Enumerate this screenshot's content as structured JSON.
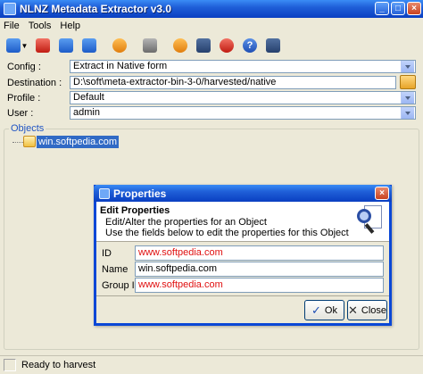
{
  "window": {
    "title": "NLNZ Metadata Extractor v3.0",
    "controls": [
      "_",
      "□",
      "×"
    ]
  },
  "menu": {
    "items": [
      "File",
      "Tools",
      "Help"
    ]
  },
  "toolbar": {
    "buttons": [
      "extract-dropdown-icon",
      "add-object-icon",
      "remove-object-icon",
      "remove-all-icon",
      "search-icon",
      "gear-icon",
      "clock-icon",
      "save-icon",
      "stopwatch-icon",
      "help-icon",
      "exit-icon"
    ],
    "help_glyph": "?"
  },
  "form": {
    "config_label": "Config :",
    "config_value": "Extract in Native form",
    "destination_label": "Destination :",
    "destination_value": "D:\\soft\\meta-extractor-bin-3-0/harvested/native",
    "profile_label": "Profile :",
    "profile_value": "Default",
    "user_label": "User :",
    "user_value": "admin"
  },
  "objects": {
    "legend": "Objects",
    "items": [
      "win.softpedia.com"
    ]
  },
  "status": {
    "text": "Ready to harvest"
  },
  "dialog": {
    "title": "Properties",
    "close": "×",
    "header_title": "Edit Properties",
    "header_line1": "Edit/Alter the properties for an Object",
    "header_line2": "Use the fields below to edit the properties for this Object",
    "id_label": "ID",
    "id_value": "www.softpedia.com",
    "name_label": "Name",
    "name_value": "win.softpedia.com",
    "group_label": "Group ID",
    "group_value": "www.softpedia.com",
    "ok_label": "Ok",
    "close_label": "Close",
    "ok_glyph": "✓",
    "close_glyph": "✕"
  },
  "colors": {
    "title_bar": "#1f5fd8",
    "selection": "#316ac5",
    "red_text": "#e01010",
    "window_bg": "#ece9d8"
  }
}
